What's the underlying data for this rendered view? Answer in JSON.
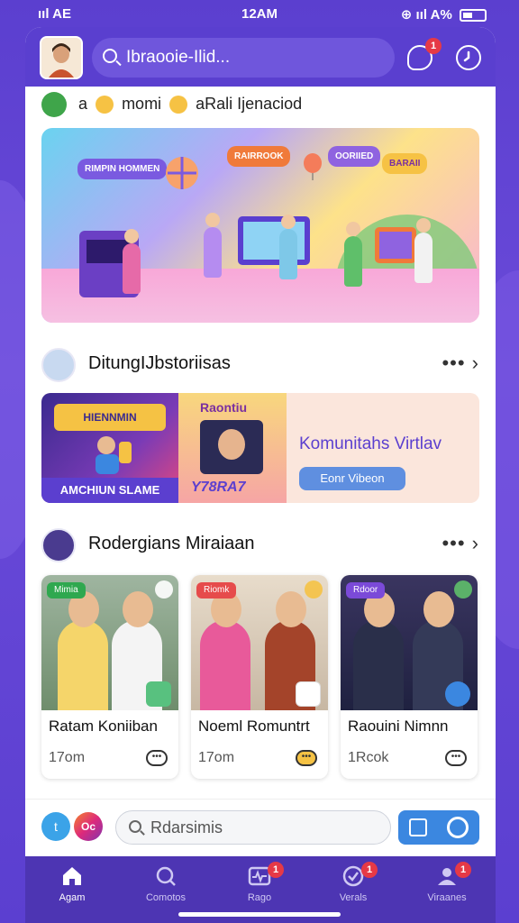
{
  "status_bar": {
    "left": "ııl AE",
    "time": "12AM",
    "right": "⊕ ııl A%"
  },
  "header": {
    "search_text": "Ibraooie-Ilid...",
    "notification_count": "1"
  },
  "stories_line": {
    "text_a": "a",
    "text_b": "momi",
    "text_c": "aRali Ijenaciod"
  },
  "banner": {
    "bubbles": [
      "RIMPIN HOMMEN",
      "RAIRROOK",
      "OORIIED",
      "BARAII"
    ]
  },
  "section1": {
    "title": "DitungIJbstoriisas",
    "more": "•••",
    "card": {
      "left_tag": "HIENNMIN",
      "left_bar": "AMCHIUN SLAME",
      "mid_tag": "Raontiu",
      "mid_sub": "Y78RA7",
      "title": "Komunitahs Virtlav",
      "button": "Eonr Vibeon"
    }
  },
  "section2": {
    "title": "Rodergians Miraiaan",
    "more": "•••",
    "cards": [
      {
        "pill": "Mimia",
        "name": "Ratam Koniiban",
        "time": "17om",
        "pill_color": "#2fa84f",
        "accent": "#58c17f"
      },
      {
        "pill": "Riomk",
        "name": "Noeml Romuntrt",
        "time": "17om",
        "pill_color": "#e64b4b",
        "accent": "#f5c244"
      },
      {
        "pill": "Rdoor",
        "name": "Raouini Nimnn",
        "time": "1Rcok",
        "pill_color": "#7b4ad8",
        "accent": "#3b87e0"
      }
    ]
  },
  "bottom_search": {
    "tw": "t",
    "ig": "Oc",
    "text": "Rdarsimis"
  },
  "tabs": [
    {
      "label": "Agam",
      "badge": "",
      "active": true
    },
    {
      "label": "Comotos",
      "badge": "",
      "active": false
    },
    {
      "label": "Rago",
      "badge": "1",
      "active": false
    },
    {
      "label": "Verals",
      "badge": "1",
      "active": false
    },
    {
      "label": "Viraanes",
      "badge": "1",
      "active": false
    }
  ]
}
